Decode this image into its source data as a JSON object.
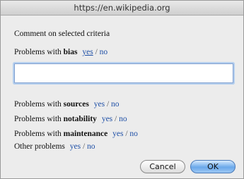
{
  "window": {
    "title": "https://en.wikipedia.org"
  },
  "dialog": {
    "heading": "Comment on selected criteria",
    "bias": {
      "prefix": "Problems with ",
      "keyword": "bias",
      "yes": "yes",
      "sep": "/",
      "no": "no"
    },
    "comment_field": {
      "value": "",
      "placeholder": ""
    },
    "sources": {
      "prefix": "Problems with ",
      "keyword": "sources",
      "yes": "yes",
      "sep": "/",
      "no": "no"
    },
    "notability": {
      "prefix": "Problems with ",
      "keyword": "notability",
      "yes": "yes",
      "sep": "/",
      "no": "no"
    },
    "maintenance": {
      "prefix": "Problems with ",
      "keyword": "maintenance",
      "yes": "yes",
      "sep": "/",
      "no": "no"
    },
    "other": {
      "label": "Other problems",
      "yes": "yes",
      "sep": "/",
      "no": "no"
    }
  },
  "buttons": {
    "cancel": "Cancel",
    "ok": "OK"
  },
  "colors": {
    "link": "#1e4fa6",
    "focus_ring": "#b5cfee",
    "default_button": "#6aa8ea"
  }
}
